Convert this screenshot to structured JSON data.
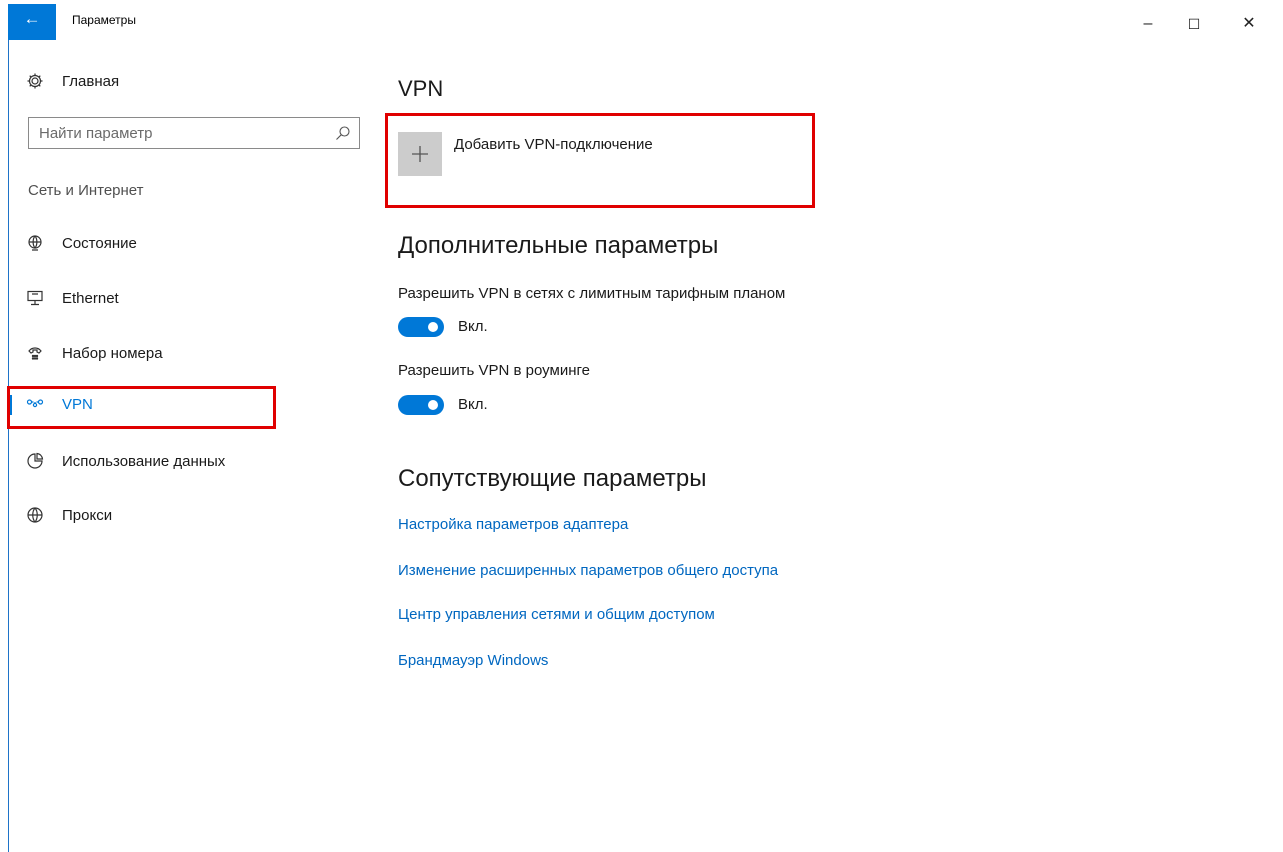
{
  "window": {
    "back_icon": "arrow-left-icon",
    "title": "Параметры",
    "controls": {
      "minimize": "–",
      "maximize": "☐",
      "close": "✕"
    }
  },
  "sidebar": {
    "home_label": "Главная",
    "search_placeholder": "Найти параметр",
    "section_label": "Сеть и Интернет",
    "items": [
      {
        "label": "Состояние",
        "icon": "globe-status-icon",
        "active": false
      },
      {
        "label": "Ethernet",
        "icon": "ethernet-icon",
        "active": false
      },
      {
        "label": "Набор номера",
        "icon": "dialup-icon",
        "active": false
      },
      {
        "label": "VPN",
        "icon": "vpn-icon",
        "active": true
      },
      {
        "label": "Использование данных",
        "icon": "data-usage-icon",
        "active": false
      },
      {
        "label": "Прокси",
        "icon": "globe-icon",
        "active": false
      }
    ]
  },
  "main": {
    "title": "VPN",
    "add_vpn_label": "Добавить VPN-подключение",
    "advanced": {
      "heading": "Дополнительные параметры",
      "metered_label": "Разрешить VPN в сетях с лимитным тарифным планом",
      "metered_state": "Вкл.",
      "roaming_label": "Разрешить VPN в роуминге",
      "roaming_state": "Вкл."
    },
    "related": {
      "heading": "Сопутствующие параметры",
      "links": [
        "Настройка параметров адаптера",
        "Изменение расширенных параметров общего доступа",
        "Центр управления сетями и общим доступом",
        "Брандмауэр Windows"
      ]
    }
  },
  "colors": {
    "accent": "#0078d7",
    "highlight": "#e00000",
    "link": "#0067c0"
  }
}
